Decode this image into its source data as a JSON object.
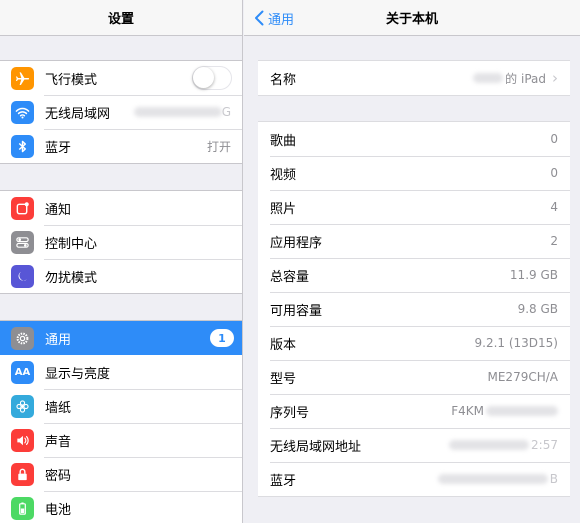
{
  "left": {
    "title": "设置",
    "groups": [
      [
        {
          "name": "airplane",
          "label": "飞行模式",
          "icon": "airplane-icon",
          "color": "#ff9500",
          "accessory": "toggle"
        },
        {
          "name": "wifi",
          "label": "无线局域网",
          "icon": "wifi-icon",
          "color": "#2e8cf8",
          "value": "G"
        },
        {
          "name": "bluetooth",
          "label": "蓝牙",
          "icon": "bluetooth-icon",
          "color": "#2e8cf8",
          "value": "打开"
        }
      ],
      [
        {
          "name": "notifications",
          "label": "通知",
          "icon": "notifications-icon",
          "color": "#fc3d39"
        },
        {
          "name": "control-center",
          "label": "控制中心",
          "icon": "switches-icon",
          "color": "#8e8e93"
        },
        {
          "name": "do-not-disturb",
          "label": "勿扰模式",
          "icon": "moon-icon",
          "color": "#5856d6"
        }
      ],
      [
        {
          "name": "general",
          "label": "通用",
          "icon": "gear-icon",
          "color": "#8e8e93",
          "badge": "1",
          "selected": true
        },
        {
          "name": "display",
          "label": "显示与亮度",
          "icon": "text-size-icon",
          "color": "#2e8cf8"
        },
        {
          "name": "wallpaper",
          "label": "墙纸",
          "icon": "flower-icon",
          "color": "#34aadc"
        },
        {
          "name": "sounds",
          "label": "声音",
          "icon": "speaker-icon",
          "color": "#fc3d39"
        },
        {
          "name": "passcode",
          "label": "密码",
          "icon": "lock-icon",
          "color": "#fc3d39"
        },
        {
          "name": "battery",
          "label": "电池",
          "icon": "battery-icon",
          "color": "#4cd964"
        }
      ]
    ]
  },
  "right": {
    "back_label": "通用",
    "title": "关于本机",
    "name_row": {
      "label": "名称",
      "value": "的 iPad"
    },
    "rows": [
      {
        "label": "歌曲",
        "value": "0"
      },
      {
        "label": "视频",
        "value": "0"
      },
      {
        "label": "照片",
        "value": "4"
      },
      {
        "label": "应用程序",
        "value": "2"
      },
      {
        "label": "总容量",
        "value": "11.9 GB"
      },
      {
        "label": "可用容量",
        "value": "9.8 GB"
      },
      {
        "label": "版本",
        "value": "9.2.1 (13D15)"
      },
      {
        "label": "型号",
        "value": "ME279CH/A"
      },
      {
        "label": "序列号",
        "value": "F4KM",
        "blurred": true
      },
      {
        "label": "无线局域网地址",
        "value": "2:57",
        "blurred": true
      },
      {
        "label": "蓝牙",
        "value": "B",
        "blurred": true
      }
    ]
  }
}
